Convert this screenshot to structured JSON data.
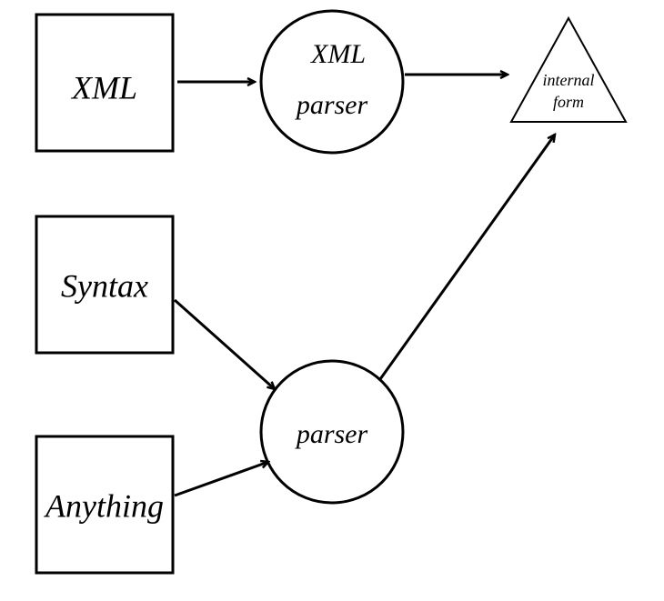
{
  "nodes": {
    "xml": {
      "label": "XML"
    },
    "xml_parser": {
      "line1": "XML",
      "line2": "parser"
    },
    "internal_form": {
      "line1": "internal",
      "line2": "form"
    },
    "syntax": {
      "label": "Syntax"
    },
    "anything": {
      "label": "Anything"
    },
    "parser": {
      "label": "parser"
    }
  },
  "chart_data": {
    "type": "diagram",
    "title": "",
    "nodes": [
      {
        "id": "xml",
        "shape": "square",
        "label": "XML"
      },
      {
        "id": "xml_parser",
        "shape": "circle",
        "label": "XML parser"
      },
      {
        "id": "internal_form",
        "shape": "triangle",
        "label": "internal form"
      },
      {
        "id": "syntax",
        "shape": "square",
        "label": "Syntax"
      },
      {
        "id": "anything",
        "shape": "square",
        "label": "Anything"
      },
      {
        "id": "parser",
        "shape": "circle",
        "label": "parser"
      }
    ],
    "edges": [
      {
        "from": "xml",
        "to": "xml_parser"
      },
      {
        "from": "xml_parser",
        "to": "internal_form"
      },
      {
        "from": "syntax",
        "to": "parser"
      },
      {
        "from": "anything",
        "to": "parser"
      },
      {
        "from": "parser",
        "to": "internal_form"
      }
    ]
  }
}
